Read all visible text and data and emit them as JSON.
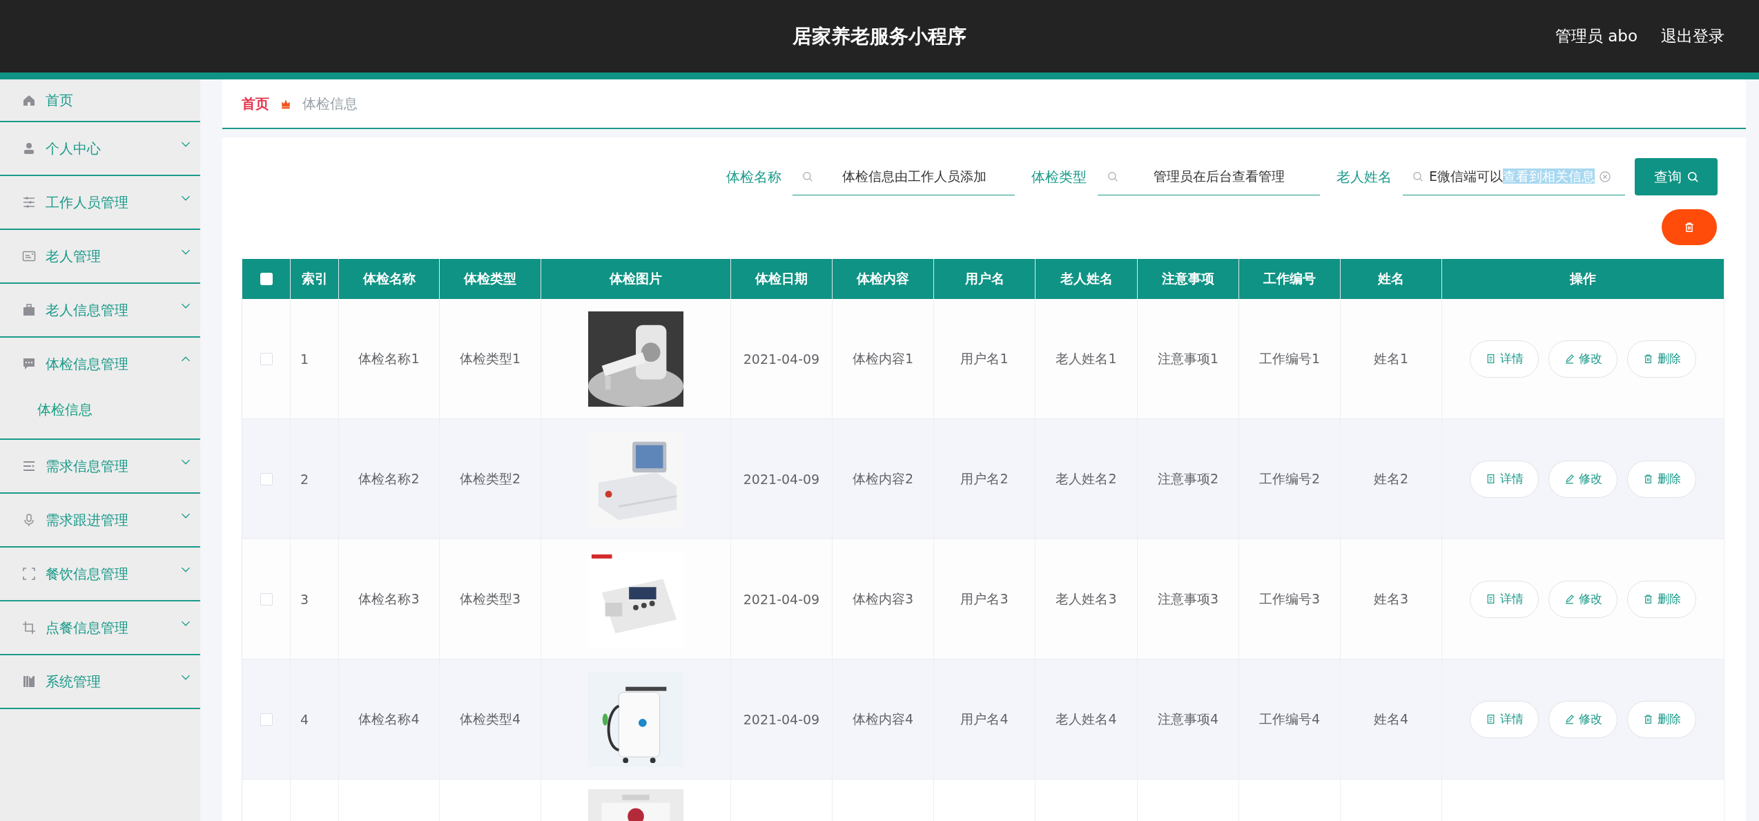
{
  "header": {
    "title": "居家养老服务小程序",
    "user": "管理员 abo",
    "logout": "退出登录"
  },
  "sidebar": {
    "items": [
      {
        "label": "首页"
      },
      {
        "label": "个人中心",
        "expanded": false
      },
      {
        "label": "工作人员管理",
        "expanded": false
      },
      {
        "label": "老人管理",
        "expanded": false
      },
      {
        "label": "老人信息管理",
        "expanded": false
      },
      {
        "label": "体检信息管理",
        "expanded": true,
        "children": [
          {
            "label": "体检信息",
            "selected": true
          }
        ]
      },
      {
        "label": "需求信息管理",
        "expanded": false
      },
      {
        "label": "需求跟进管理",
        "expanded": false
      },
      {
        "label": "餐饮信息管理",
        "expanded": false
      },
      {
        "label": "点餐信息管理",
        "expanded": false
      },
      {
        "label": "系统管理",
        "expanded": false
      }
    ]
  },
  "breadcrumb": [
    "首页",
    "体检信息"
  ],
  "search": {
    "fields": [
      {
        "label": "体检名称",
        "value": "体检信息由工作人员添加"
      },
      {
        "label": "体检类型",
        "value": "管理员在后台查看管理"
      },
      {
        "label": "老人姓名",
        "value": "E微信端可以",
        "highlighted_value": "查看到相关信息",
        "clearable": true
      }
    ],
    "button": "查询"
  },
  "table": {
    "header_checked": false,
    "columns": [
      "索引",
      "体检名称",
      "体检类型",
      "体检图片",
      "体检日期",
      "体检内容",
      "用户名",
      "老人姓名",
      "注意事项",
      "工作编号",
      "姓名",
      "操作"
    ],
    "rows": [
      {
        "checked": false,
        "cells": [
          "1",
          "体检名称1",
          "体检类型1",
          {
            "kind": "picture"
          },
          "2021-04-09",
          "体检内容1",
          "用户名1",
          "老人姓名1",
          "注意事项1",
          "工作编号1",
          "姓名1"
        ],
        "actions": [
          "详情",
          "修改",
          "删除"
        ]
      },
      {
        "checked": false,
        "cells": [
          "2",
          "体检名称2",
          "体检类型2",
          {
            "kind": "picture"
          },
          "2021-04-09",
          "体检内容2",
          "用户名2",
          "老人姓名2",
          "注意事项2",
          "工作编号2",
          "姓名2"
        ],
        "actions": [
          "详情",
          "修改",
          "删除"
        ]
      },
      {
        "checked": false,
        "cells": [
          "3",
          "体检名称3",
          "体检类型3",
          {
            "kind": "picture"
          },
          "2021-04-09",
          "体检内容3",
          "用户名3",
          "老人姓名3",
          "注意事项3",
          "工作编号3",
          "姓名3"
        ],
        "actions": [
          "详情",
          "修改",
          "删除"
        ]
      },
      {
        "checked": false,
        "cells": [
          "4",
          "体检名称4",
          "体检类型4",
          {
            "kind": "picture"
          },
          "2021-04-09",
          "体检内容4",
          "用户名4",
          "老人姓名4",
          "注意事项4",
          "工作编号4",
          "姓名4"
        ],
        "actions": [
          "详情",
          "修改",
          "删除"
        ]
      }
    ],
    "partial_row": {
      "kind": "picture"
    }
  }
}
